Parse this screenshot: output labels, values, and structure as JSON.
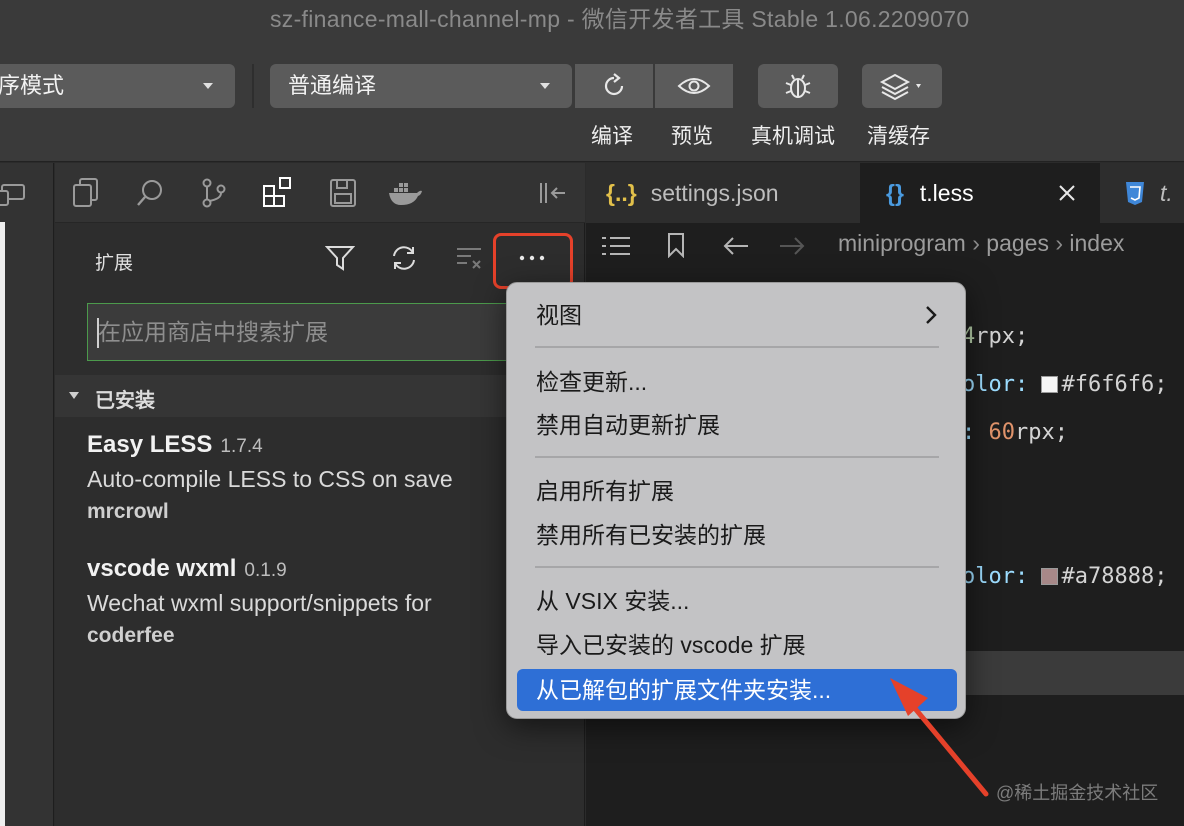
{
  "window": {
    "title": "sz-finance-mall-channel-mp  -  微信开发者工具 Stable 1.06.2209070"
  },
  "toolbar": {
    "mode_select": "序模式",
    "compile_select": "普通编译",
    "compile_label": "编译",
    "preview_label": "预览",
    "debug_label": "真机调试",
    "clear_cache_label": "清缓存"
  },
  "sidebar": {
    "title": "扩展",
    "search": {
      "placeholder": "在应用商店中搜索扩展",
      "value": ""
    },
    "installed_section": "已安装",
    "extensions": [
      {
        "name": "Easy LESS",
        "version": "1.7.4",
        "description": "Auto-compile LESS to CSS on save",
        "author": "mrcrowl"
      },
      {
        "name": "vscode wxml",
        "version": "0.1.9",
        "description": "Wechat wxml support/snippets for",
        "author": "coderfee"
      }
    ]
  },
  "editor": {
    "tabs": [
      {
        "label": "settings.json",
        "icon": "{..}"
      },
      {
        "label": "t.less",
        "icon": "{}",
        "active": true
      },
      {
        "label": "t.",
        "icon": "css-3-icon"
      }
    ],
    "breadcrumb": [
      "miniprogram",
      "pages",
      "index"
    ],
    "code_lines": [
      {
        "num": "4",
        "unit": "rpx;"
      },
      {
        "prop": "olor: ",
        "color": "#f6f6f6",
        "value": "#f6f6f6;"
      },
      {
        "prop": ": ",
        "num": "60",
        "unit": "rpx;"
      },
      {
        "prop": "olor: ",
        "color": "#a78888",
        "value": "#a78888;"
      }
    ]
  },
  "context_menu": {
    "items": [
      {
        "label": "视图",
        "submenu": true
      },
      {
        "label": "检查更新..."
      },
      {
        "label": "禁用自动更新扩展"
      },
      {
        "label": "启用所有扩展"
      },
      {
        "label": "禁用所有已安装的扩展"
      },
      {
        "label": "从 VSIX 安装..."
      },
      {
        "label": "导入已安装的 vscode 扩展"
      },
      {
        "label": "从已解包的扩展文件夹安装...",
        "selected": true
      }
    ]
  },
  "annotation": {
    "highlight_color": "#e5412a",
    "watermark": "@稀土掘金技术社区"
  },
  "colors": {
    "accent": "#2e6fd6",
    "search_border": "#4c9a4c"
  }
}
